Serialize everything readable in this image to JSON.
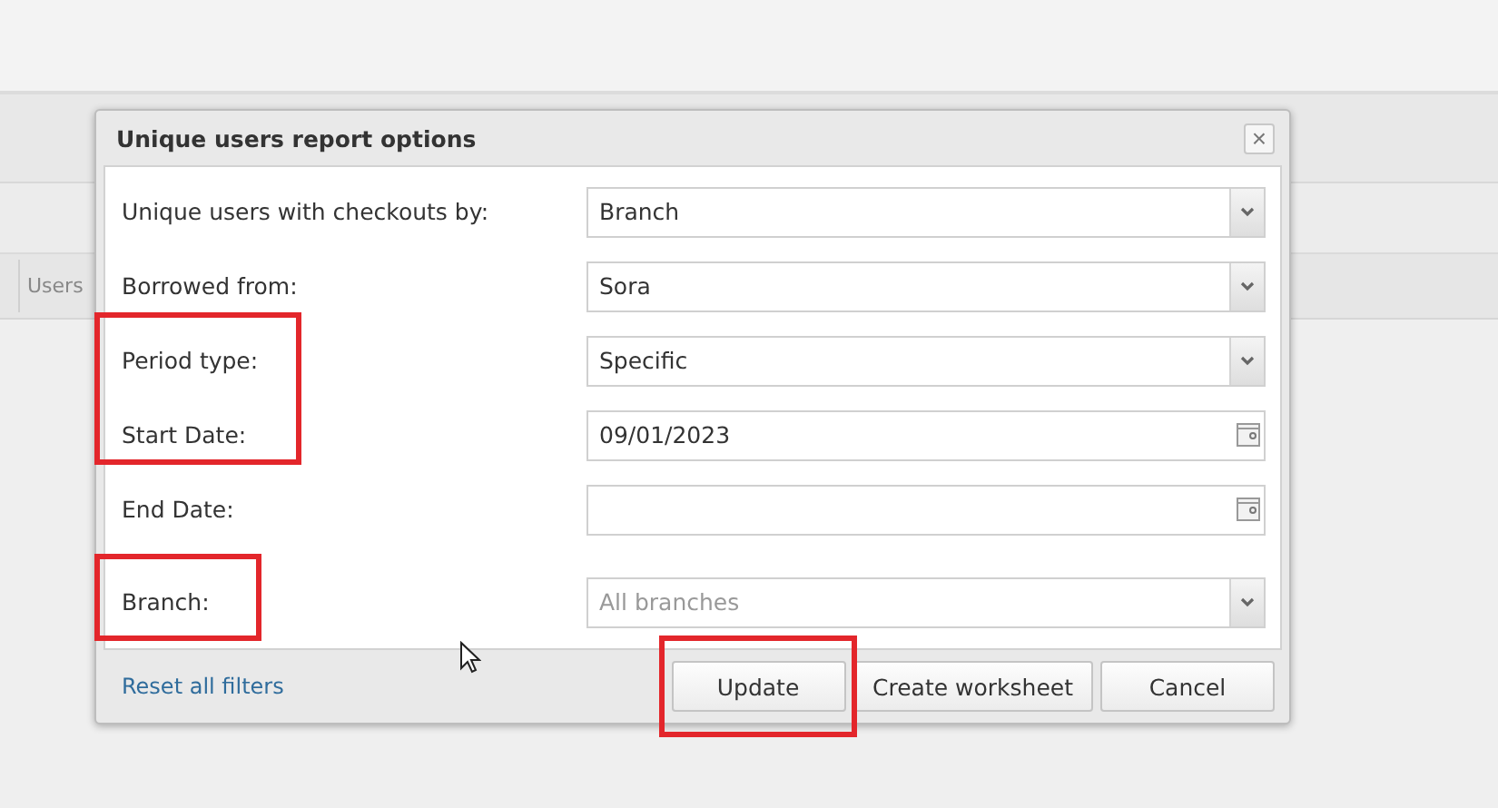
{
  "background_tab": {
    "label": "Users"
  },
  "dialog": {
    "title": "Unique users report options",
    "close": "×",
    "fields": [
      {
        "label": "Unique users with checkouts by:",
        "kind": "select",
        "value": "Branch"
      },
      {
        "label": "Borrowed from:",
        "kind": "select",
        "value": "Sora"
      },
      {
        "label": "Period type:",
        "kind": "select",
        "value": "Specific"
      },
      {
        "label": "Start Date:",
        "kind": "date",
        "value": "09/01/2023"
      },
      {
        "label": "End Date:",
        "kind": "date"
      },
      {
        "label": "Branch:",
        "kind": "select",
        "placeholder": "All branches"
      }
    ],
    "reset_link": "Reset all filters",
    "buttons": [
      "Update",
      "Create worksheet",
      "Cancel"
    ]
  }
}
